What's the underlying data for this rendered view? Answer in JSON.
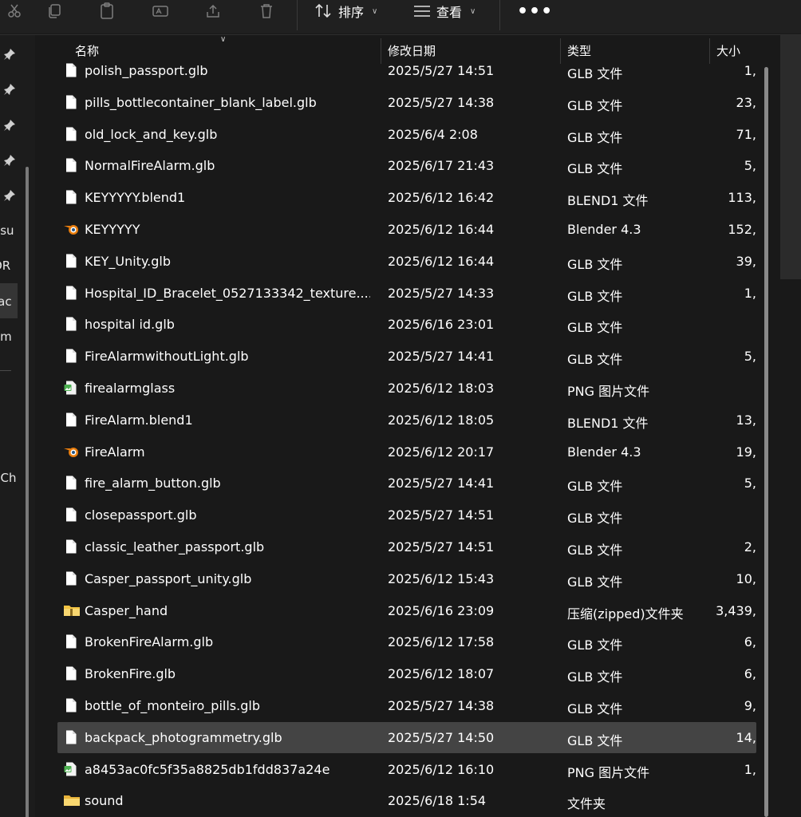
{
  "toolbar": {
    "sort_label": "排序",
    "view_label": "查看",
    "more_label": "•••"
  },
  "nav": {
    "items": [
      {
        "label": "esu"
      },
      {
        "label": "OR"
      },
      {
        "label": "rac"
      },
      {
        "label": "om"
      },
      {
        "label": "dCh"
      }
    ]
  },
  "columns": {
    "name": "名称",
    "date": "修改日期",
    "type": "类型",
    "size": "大小"
  },
  "files": [
    {
      "name": "polish_passport.glb",
      "date": "2025/5/27 14:51",
      "type": "GLB 文件",
      "size": "1,",
      "icon": "file-icon"
    },
    {
      "name": "pills_bottlecontainer_blank_label.glb",
      "date": "2025/5/27 14:38",
      "type": "GLB 文件",
      "size": "23,",
      "icon": "file-icon"
    },
    {
      "name": "old_lock_and_key.glb",
      "date": "2025/6/4 2:08",
      "type": "GLB 文件",
      "size": "71,",
      "icon": "file-icon"
    },
    {
      "name": "NormalFireAlarm.glb",
      "date": "2025/6/17 21:43",
      "type": "GLB 文件",
      "size": "5,",
      "icon": "file-icon"
    },
    {
      "name": "KEYYYYY.blend1",
      "date": "2025/6/12 16:42",
      "type": "BLEND1 文件",
      "size": "113,",
      "icon": "file-icon"
    },
    {
      "name": "KEYYYYY",
      "date": "2025/6/12 16:44",
      "type": "Blender 4.3",
      "size": "152,",
      "icon": "blender-icon"
    },
    {
      "name": "KEY_Unity.glb",
      "date": "2025/6/12 16:44",
      "type": "GLB 文件",
      "size": "39,",
      "icon": "file-icon"
    },
    {
      "name": "Hospital_ID_Bracelet_0527133342_texture....",
      "date": "2025/5/27 14:33",
      "type": "GLB 文件",
      "size": "1,",
      "icon": "file-icon"
    },
    {
      "name": "hospital id.glb",
      "date": "2025/6/16 23:01",
      "type": "GLB 文件",
      "size": "",
      "icon": "file-icon"
    },
    {
      "name": "FireAlarmwithoutLight.glb",
      "date": "2025/5/27 14:41",
      "type": "GLB 文件",
      "size": "5,",
      "icon": "file-icon"
    },
    {
      "name": "firealarmglass",
      "date": "2025/6/12 18:03",
      "type": "PNG 图片文件",
      "size": "",
      "icon": "image-file-icon"
    },
    {
      "name": "FireAlarm.blend1",
      "date": "2025/6/12 18:05",
      "type": "BLEND1 文件",
      "size": "13,",
      "icon": "file-icon"
    },
    {
      "name": "FireAlarm",
      "date": "2025/6/12 20:17",
      "type": "Blender 4.3",
      "size": "19,",
      "icon": "blender-icon"
    },
    {
      "name": "fire_alarm_button.glb",
      "date": "2025/5/27 14:41",
      "type": "GLB 文件",
      "size": "5,",
      "icon": "file-icon"
    },
    {
      "name": "closepassport.glb",
      "date": "2025/5/27 14:51",
      "type": "GLB 文件",
      "size": "",
      "icon": "file-icon"
    },
    {
      "name": "classic_leather_passport.glb",
      "date": "2025/5/27 14:51",
      "type": "GLB 文件",
      "size": "2,",
      "icon": "file-icon"
    },
    {
      "name": "Casper_passport_unity.glb",
      "date": "2025/6/12 15:43",
      "type": "GLB 文件",
      "size": "10,",
      "icon": "file-icon"
    },
    {
      "name": "Casper_hand",
      "date": "2025/6/16 23:09",
      "type": "压缩(zipped)文件夹",
      "size": "3,439,",
      "icon": "zip-folder-icon"
    },
    {
      "name": "BrokenFireAlarm.glb",
      "date": "2025/6/12 17:58",
      "type": "GLB 文件",
      "size": "6,",
      "icon": "file-icon"
    },
    {
      "name": "BrokenFire.glb",
      "date": "2025/6/12 18:07",
      "type": "GLB 文件",
      "size": "6,",
      "icon": "file-icon"
    },
    {
      "name": "bottle_of_monteiro_pills.glb",
      "date": "2025/5/27 14:38",
      "type": "GLB 文件",
      "size": "9,",
      "icon": "file-icon"
    },
    {
      "name": "backpack_photogrammetry.glb",
      "date": "2025/5/27 14:50",
      "type": "GLB 文件",
      "size": "14,",
      "icon": "file-icon",
      "selected": true
    },
    {
      "name": "a8453ac0fc5f35a8825db1fdd837a24e",
      "date": "2025/6/12 16:10",
      "type": "PNG 图片文件",
      "size": "1,",
      "icon": "image-file-icon"
    },
    {
      "name": "sound",
      "date": "2025/6/18 1:54",
      "type": "文件夹",
      "size": "",
      "icon": "folder-icon"
    }
  ],
  "colors": {
    "background": "#191919",
    "selected_row": "#444444",
    "text": "#ffffff",
    "folder": "#f3c443",
    "blender": "#e87d0d"
  }
}
